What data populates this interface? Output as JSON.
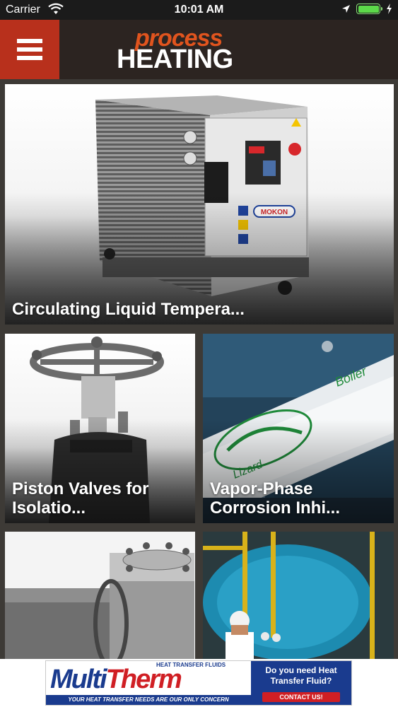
{
  "status_bar": {
    "carrier": "Carrier",
    "time": "10:01 AM",
    "battery_level": 1.0
  },
  "header": {
    "menu_icon": "hamburger-menu-icon",
    "logo_top": "process",
    "logo_bottom": "HEATING",
    "colors": {
      "menu_bg": "#b8301c",
      "header_bg": "#2c2421",
      "logo_accent": "#e0541e"
    }
  },
  "tiles": [
    {
      "caption": "Circulating Liquid Tempera..."
    },
    {
      "caption": "Piston Valves for Isolatio..."
    },
    {
      "caption": "Vapor-Phase Corrosion Inhi..."
    },
    {
      "caption": ""
    },
    {
      "caption": ""
    }
  ],
  "ad": {
    "brand_pre": "Multi",
    "brand_post": "Therm",
    "tagline_top": "HEAT TRANSFER FLUIDS",
    "tagline_bottom": "YOUR HEAT TRANSFER NEEDS ARE OUR ONLY CONCERN",
    "question": "Do you need Heat Transfer Fluid?",
    "cta": "CONTACT US!"
  }
}
